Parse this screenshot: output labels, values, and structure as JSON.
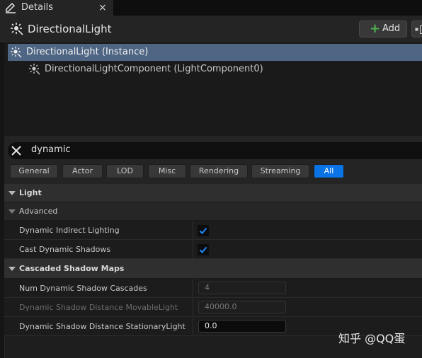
{
  "tab": {
    "title": "Details",
    "close_glyph": "×",
    "icon": "pencil-icon"
  },
  "header": {
    "actor_name": "DirectionalLight",
    "actor_icon": "directional-light-icon",
    "add_label": "Add",
    "add_glyph": "+"
  },
  "tree": {
    "items": [
      {
        "label": "DirectionalLight (Instance)",
        "selected": true
      },
      {
        "label": "DirectionalLightComponent (LightComponent0)",
        "selected": false
      }
    ]
  },
  "search": {
    "value": "dynamic"
  },
  "filters": [
    {
      "label": "General",
      "active": false
    },
    {
      "label": "Actor",
      "active": false
    },
    {
      "label": "LOD",
      "active": false
    },
    {
      "label": "Misc",
      "active": false
    },
    {
      "label": "Rendering",
      "active": false
    },
    {
      "label": "Streaming",
      "active": false
    },
    {
      "label": "All",
      "active": true
    }
  ],
  "properties": {
    "light_category": "Light",
    "advanced_label": "Advanced",
    "dynamic_indirect_lighting": {
      "label": "Dynamic Indirect Lighting",
      "checked": true
    },
    "cast_dynamic_shadows": {
      "label": "Cast Dynamic Shadows",
      "checked": true
    },
    "cascaded_category": "Cascaded Shadow Maps",
    "num_cascades": {
      "label": "Num Dynamic Shadow Cascades",
      "value": "4",
      "enabled": false
    },
    "movable_distance": {
      "label": "Dynamic Shadow Distance MovableLight",
      "value": "40000.0",
      "enabled": false
    },
    "stationary_distance": {
      "label": "Dynamic Shadow Distance StationaryLight",
      "value": "0.0",
      "enabled": true
    }
  },
  "watermark": "知乎 @QQ蛋",
  "colors": {
    "accent": "#0a74e6",
    "selection": "#4e6583",
    "add_plus": "#4fb14f",
    "check": "#1d8cff"
  }
}
